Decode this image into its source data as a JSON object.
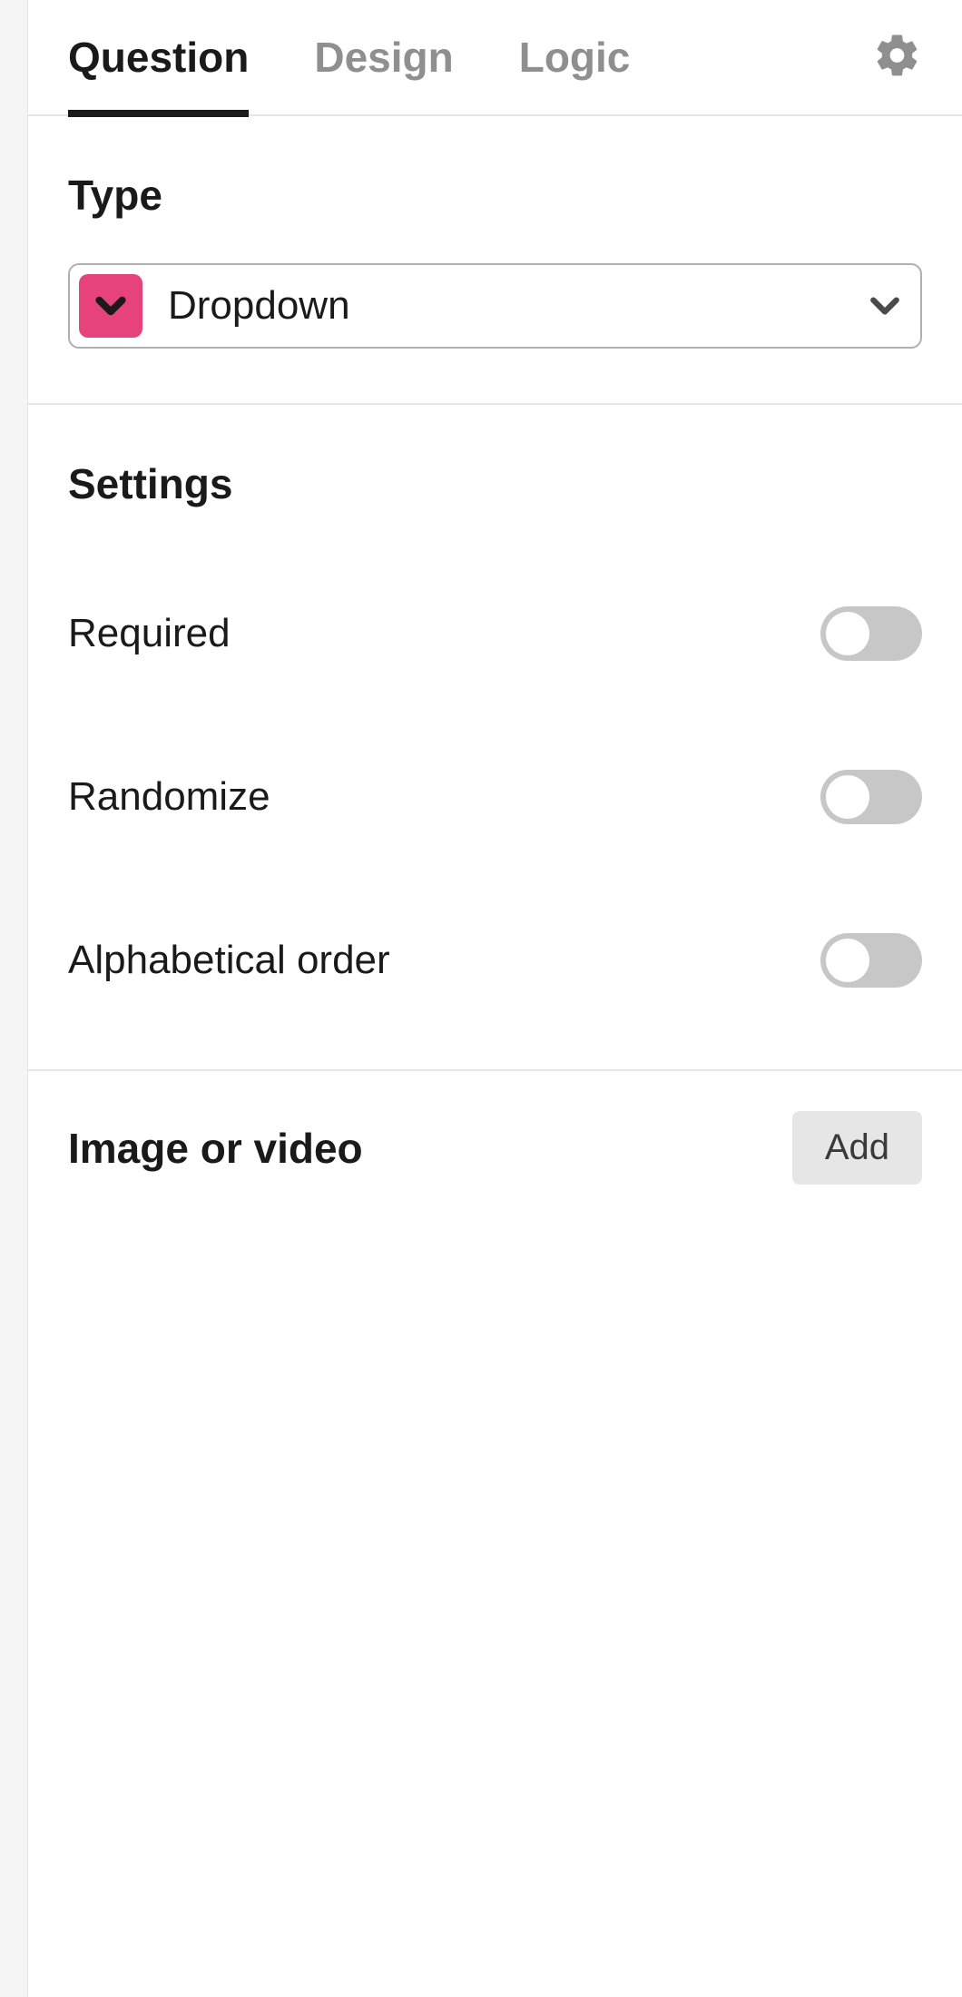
{
  "tabs": {
    "question": "Question",
    "design": "Design",
    "logic": "Logic"
  },
  "type": {
    "heading": "Type",
    "selected_label": "Dropdown",
    "icon_color": "#e6437c"
  },
  "settings": {
    "heading": "Settings",
    "items": [
      {
        "label": "Required",
        "on": false
      },
      {
        "label": "Randomize",
        "on": false
      },
      {
        "label": "Alphabetical order",
        "on": false
      }
    ]
  },
  "media": {
    "heading": "Image or video",
    "add_label": "Add"
  }
}
